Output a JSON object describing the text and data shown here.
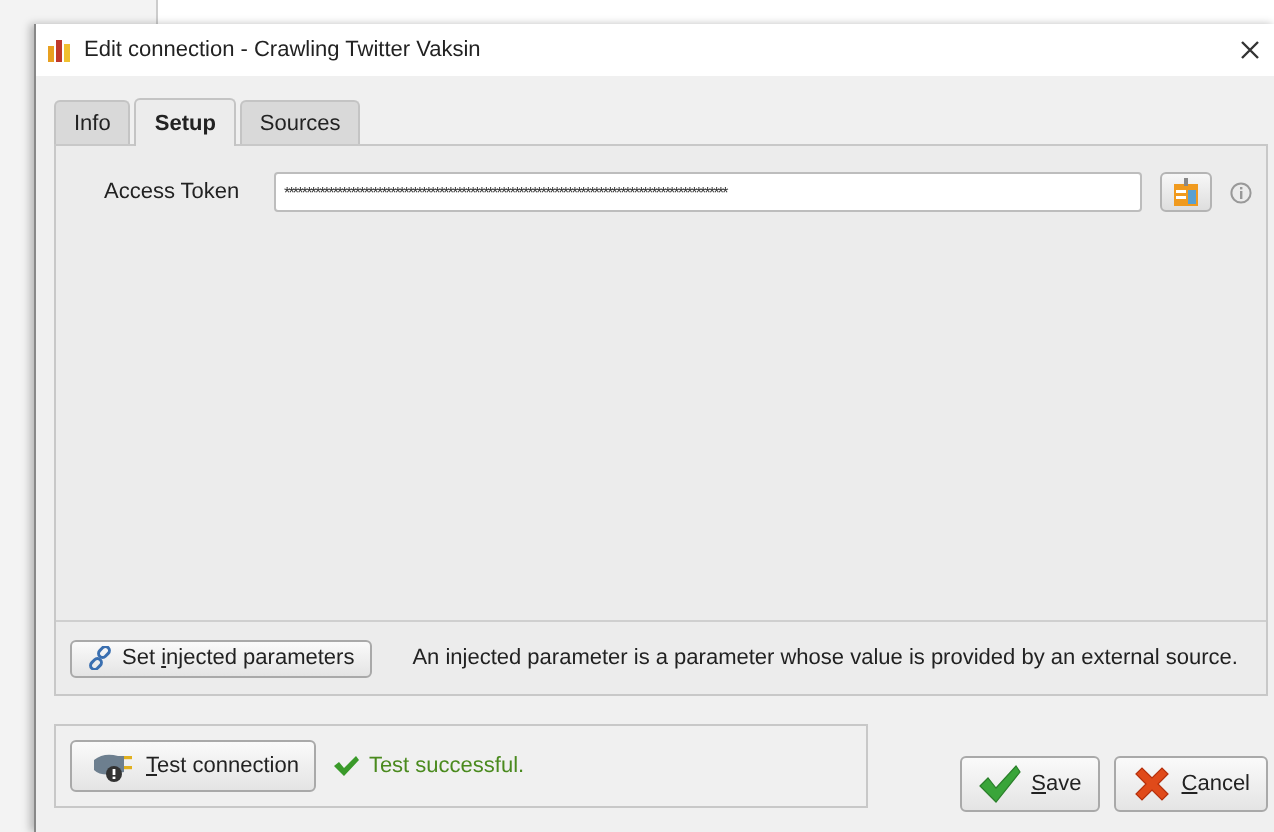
{
  "window": {
    "title": "Edit connection - Crawling Twitter Vaksin"
  },
  "tabs": [
    {
      "label": "Info",
      "selected": false
    },
    {
      "label": "Setup",
      "selected": true
    },
    {
      "label": "Sources",
      "selected": false
    }
  ],
  "access_token": {
    "label": "Access Token",
    "value": "****************************************************************************************************"
  },
  "injected": {
    "button": {
      "before": "Set ",
      "mnemonic": "i",
      "after": "njected parameters"
    },
    "note": "An injected parameter is a parameter whose value is provided by an external source."
  },
  "test": {
    "button": {
      "mnemonic": "T",
      "after": "est connection"
    },
    "status": "Test successful.",
    "success": true
  },
  "buttons": [
    {
      "kind": "save",
      "mnemonic": "S",
      "after": "ave"
    },
    {
      "kind": "cancel",
      "mnemonic": "C",
      "after": "ancel"
    }
  ]
}
